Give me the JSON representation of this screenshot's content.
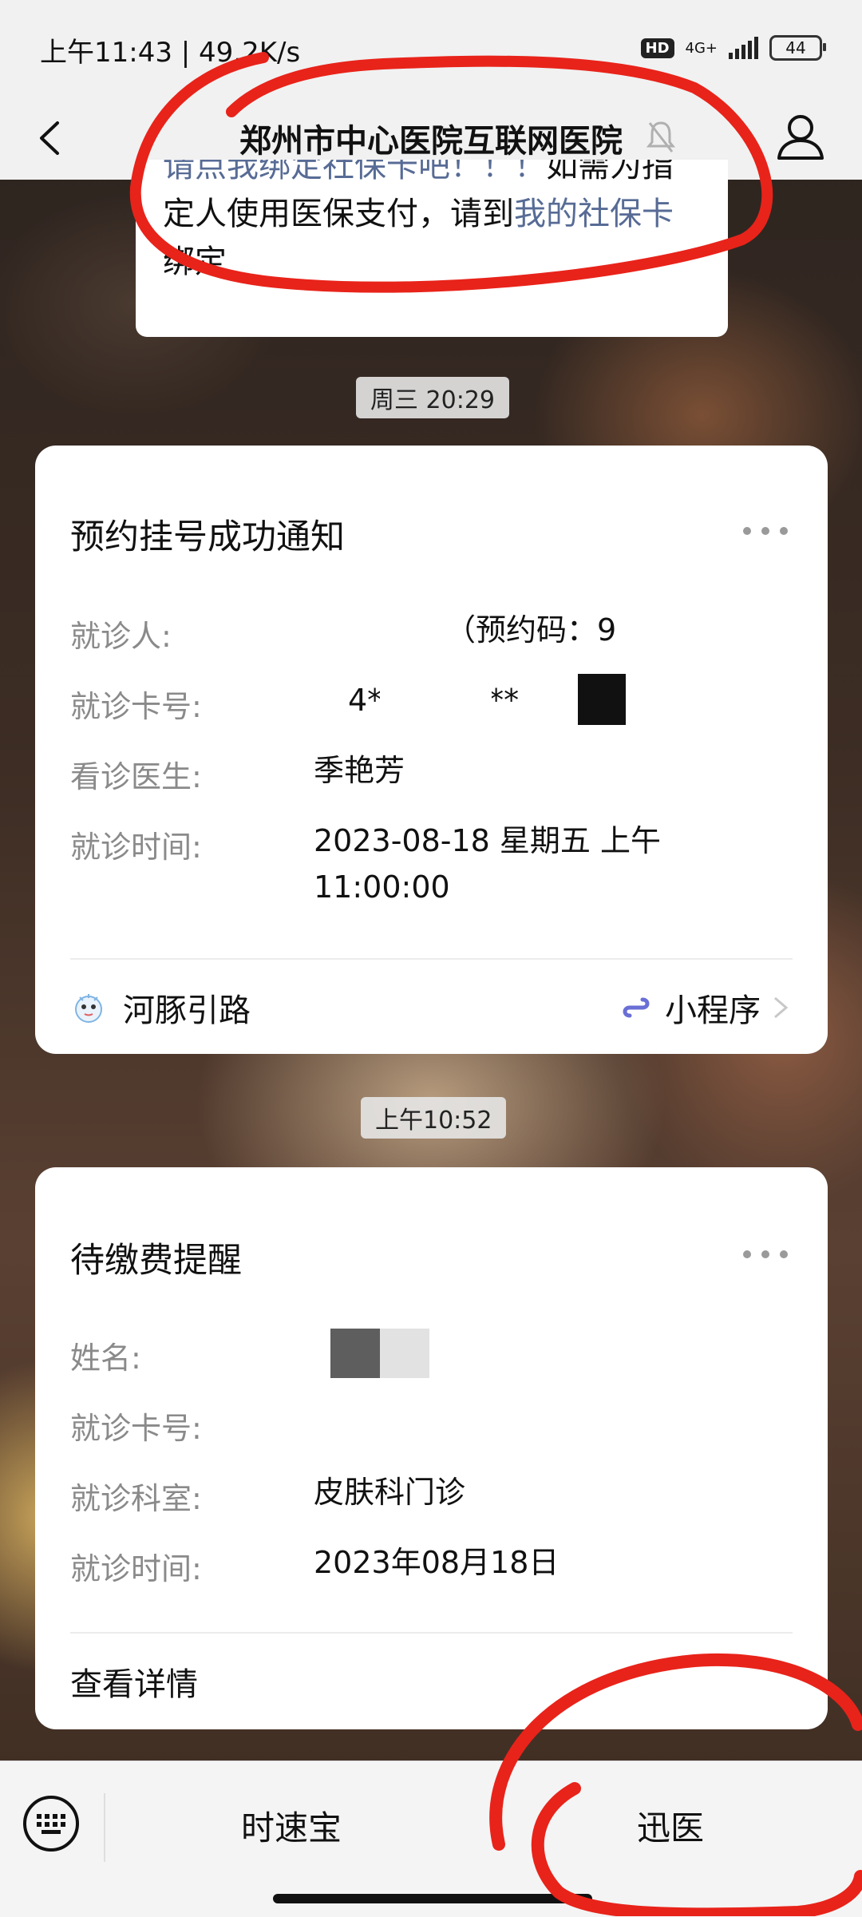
{
  "status_bar": {
    "time": "上午11:43 | 49.2K/s",
    "hd": "HD",
    "network": "4G+",
    "battery": "44"
  },
  "nav": {
    "title": "郑州市中心医院互联网医院"
  },
  "top_message": {
    "part1": "请点我绑定社保卡吧！！！",
    "part2": "如需为指定人使用医保支付，请到",
    "link": "我的社保卡",
    "part3": "绑定"
  },
  "timestamps": {
    "first": "周三 20:29",
    "second": "上午10:52"
  },
  "card1": {
    "title": "预约挂号成功通知",
    "rows": [
      {
        "label": "就诊人:",
        "value": "（预约码：9"
      },
      {
        "label": "就诊卡号:",
        "value": "4**********"
      },
      {
        "label": "看诊医生:",
        "value": "季艳芳"
      },
      {
        "label": "就诊时间:",
        "value": "2023-08-18 星期五 上午 11:00:00"
      }
    ],
    "footer_left": "河豚引路",
    "footer_right": "小程序"
  },
  "card2": {
    "title": "待缴费提醒",
    "rows": [
      {
        "label": "姓名:",
        "value": ""
      },
      {
        "label": "就诊卡号:",
        "value": ""
      },
      {
        "label": "就诊科室:",
        "value": "皮肤科门诊"
      },
      {
        "label": "就诊时间:",
        "value": "2023年08月18日"
      }
    ],
    "footer": "查看详情"
  },
  "bottom_menu": {
    "item1": "时速宝",
    "item2": "迅医"
  },
  "colors": {
    "link": "#576b95",
    "annotation": "#e8231a"
  }
}
